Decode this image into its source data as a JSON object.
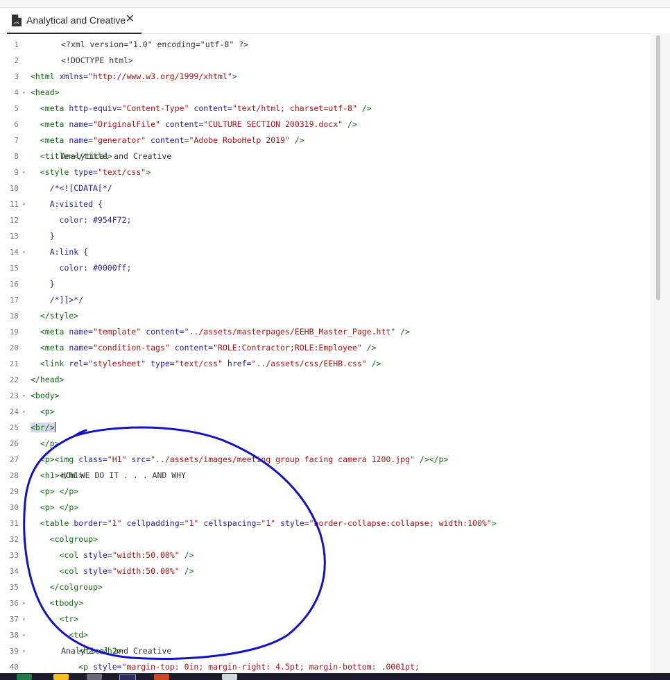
{
  "tab": {
    "title": "Analytical and Creative",
    "icon": "html-file-icon",
    "close_glyph": "✕"
  },
  "editor": {
    "lines": [
      {
        "n": "1",
        "fold": "",
        "segs": [
          {
            "t": "<?xml version=\"1.0\" encoding=\"utf-8\" ?>",
            "c": "code"
          }
        ]
      },
      {
        "n": "2",
        "fold": "",
        "segs": [
          {
            "t": "<!DOCTYPE html>",
            "c": "code"
          }
        ]
      },
      {
        "n": "3",
        "fold": "",
        "segs": [
          {
            "t": "<html ",
            "c": "tg"
          },
          {
            "t": "xmlns=",
            "c": "at"
          },
          {
            "t": "\"http://www.w3.org/1999/xhtml\"",
            "c": "st"
          },
          {
            "t": ">",
            "c": "tg"
          }
        ]
      },
      {
        "n": "4",
        "fold": "▾",
        "segs": [
          {
            "t": "<head>",
            "c": "tg"
          }
        ]
      },
      {
        "n": "5",
        "fold": "",
        "segs": [
          {
            "t": "  <meta ",
            "c": "tg"
          },
          {
            "t": "http-equiv=",
            "c": "at"
          },
          {
            "t": "\"Content-Type\"",
            "c": "st"
          },
          {
            "t": " content=",
            "c": "at"
          },
          {
            "t": "\"text/html; charset=utf-8\"",
            "c": "st"
          },
          {
            "t": " />",
            "c": "tg"
          }
        ]
      },
      {
        "n": "6",
        "fold": "",
        "segs": [
          {
            "t": "  <meta ",
            "c": "tg"
          },
          {
            "t": "name=",
            "c": "at"
          },
          {
            "t": "\"OriginalFile\"",
            "c": "st"
          },
          {
            "t": " content=",
            "c": "at"
          },
          {
            "t": "\"CULTURE SECTION 200319.docx\"",
            "c": "st"
          },
          {
            "t": " />",
            "c": "tg"
          }
        ]
      },
      {
        "n": "7",
        "fold": "",
        "segs": [
          {
            "t": "  <meta ",
            "c": "tg"
          },
          {
            "t": "name=",
            "c": "at"
          },
          {
            "t": "\"generator\"",
            "c": "st"
          },
          {
            "t": " content=",
            "c": "at"
          },
          {
            "t": "\"Adobe RoboHelp 2019\"",
            "c": "st"
          },
          {
            "t": " />",
            "c": "tg"
          }
        ]
      },
      {
        "n": "8",
        "fold": "",
        "segs": [
          {
            "t": "  <title>",
            "c": "tg"
          },
          {
            "t": "Analytical and Creative",
            "c": "code"
          },
          {
            "t": "</title>",
            "c": "tg"
          }
        ]
      },
      {
        "n": "9",
        "fold": "▾",
        "segs": [
          {
            "t": "  <style ",
            "c": "tg"
          },
          {
            "t": "type=",
            "c": "at"
          },
          {
            "t": "\"text/css\"",
            "c": "st"
          },
          {
            "t": ">",
            "c": "tg"
          }
        ]
      },
      {
        "n": "10",
        "fold": "",
        "segs": [
          {
            "t": "    /*<![CDATA[*/",
            "c": "cm"
          }
        ]
      },
      {
        "n": "11",
        "fold": "▾",
        "segs": [
          {
            "t": "    A:visited {",
            "c": "cm"
          }
        ]
      },
      {
        "n": "12",
        "fold": "",
        "segs": [
          {
            "t": "      color: #954F72;",
            "c": "cm"
          }
        ]
      },
      {
        "n": "13",
        "fold": "",
        "segs": [
          {
            "t": "    }",
            "c": "cm"
          }
        ]
      },
      {
        "n": "14",
        "fold": "▾",
        "segs": [
          {
            "t": "    A:link {",
            "c": "cm"
          }
        ]
      },
      {
        "n": "15",
        "fold": "",
        "segs": [
          {
            "t": "      color: #0000ff;",
            "c": "cm"
          }
        ]
      },
      {
        "n": "16",
        "fold": "",
        "segs": [
          {
            "t": "    }",
            "c": "cm"
          }
        ]
      },
      {
        "n": "17",
        "fold": "",
        "segs": [
          {
            "t": "    /*]]>*/",
            "c": "cm"
          }
        ]
      },
      {
        "n": "18",
        "fold": "",
        "segs": [
          {
            "t": "  </style>",
            "c": "tg"
          }
        ]
      },
      {
        "n": "19",
        "fold": "",
        "segs": [
          {
            "t": "  <meta ",
            "c": "tg"
          },
          {
            "t": "name=",
            "c": "at"
          },
          {
            "t": "\"template\"",
            "c": "st"
          },
          {
            "t": " content=",
            "c": "at"
          },
          {
            "t": "\"../assets/masterpages/EEHB_Master_Page.htt\"",
            "c": "st"
          },
          {
            "t": " />",
            "c": "tg"
          }
        ]
      },
      {
        "n": "20",
        "fold": "",
        "segs": [
          {
            "t": "  <meta ",
            "c": "tg"
          },
          {
            "t": "name=",
            "c": "at"
          },
          {
            "t": "\"condition-tags\"",
            "c": "st"
          },
          {
            "t": " content=",
            "c": "at"
          },
          {
            "t": "\"ROLE:Contractor;ROLE:Employee\"",
            "c": "st"
          },
          {
            "t": " />",
            "c": "tg"
          }
        ]
      },
      {
        "n": "21",
        "fold": "",
        "segs": [
          {
            "t": "  <link ",
            "c": "tg"
          },
          {
            "t": "rel=",
            "c": "at"
          },
          {
            "t": "\"stylesheet\"",
            "c": "st"
          },
          {
            "t": " type=",
            "c": "at"
          },
          {
            "t": "\"text/css\"",
            "c": "st"
          },
          {
            "t": " href=",
            "c": "at"
          },
          {
            "t": "\"../assets/css/EEHB.css\"",
            "c": "st"
          },
          {
            "t": " />",
            "c": "tg"
          }
        ]
      },
      {
        "n": "22",
        "fold": "",
        "segs": [
          {
            "t": "</head>",
            "c": "tg"
          }
        ]
      },
      {
        "n": "23",
        "fold": "▾",
        "segs": [
          {
            "t": "<body>",
            "c": "tg"
          }
        ]
      },
      {
        "n": "24",
        "fold": "▾",
        "segs": [
          {
            "t": "  <p>",
            "c": "tg"
          }
        ]
      },
      {
        "n": "25",
        "fold": "",
        "segs": [
          {
            "t": "    ",
            "c": "code"
          },
          {
            "t": "<br/>",
            "c": "tg sel"
          },
          {
            "t": "",
            "c": "caret"
          }
        ]
      },
      {
        "n": "26",
        "fold": "",
        "segs": [
          {
            "t": "  </p>",
            "c": "tg"
          }
        ]
      },
      {
        "n": "27",
        "fold": "",
        "segs": [
          {
            "t": "  <p>",
            "c": "tg"
          },
          {
            "t": "<img ",
            "c": "tg"
          },
          {
            "t": "class=",
            "c": "at"
          },
          {
            "t": "\"H1\"",
            "c": "st"
          },
          {
            "t": " src=",
            "c": "at"
          },
          {
            "t": "\"../assets/images/meeting group facing camera 1200.jpg\"",
            "c": "st"
          },
          {
            "t": " /></p>",
            "c": "tg"
          }
        ]
      },
      {
        "n": "28",
        "fold": "",
        "segs": [
          {
            "t": "  <h1>",
            "c": "tg"
          },
          {
            "t": "HOW WE DO IT . . . AND WHY",
            "c": "code"
          },
          {
            "t": "</h1>",
            "c": "tg"
          }
        ]
      },
      {
        "n": "29",
        "fold": "",
        "segs": [
          {
            "t": "  <p> </p>",
            "c": "tg"
          }
        ]
      },
      {
        "n": "30",
        "fold": "",
        "segs": [
          {
            "t": "  <p> </p>",
            "c": "tg"
          }
        ]
      },
      {
        "n": "31",
        "fold": "▾",
        "segs": [
          {
            "t": "  <table ",
            "c": "tg"
          },
          {
            "t": "border=",
            "c": "at"
          },
          {
            "t": "\"1\"",
            "c": "st"
          },
          {
            "t": " cellpadding=",
            "c": "at"
          },
          {
            "t": "\"1\"",
            "c": "st"
          },
          {
            "t": " cellspacing=",
            "c": "at"
          },
          {
            "t": "\"1\"",
            "c": "st"
          },
          {
            "t": " style=",
            "c": "at"
          },
          {
            "t": "\"border-collapse:collapse; width:100%\"",
            "c": "st"
          },
          {
            "t": ">",
            "c": "tg"
          }
        ]
      },
      {
        "n": "32",
        "fold": "▾",
        "segs": [
          {
            "t": "    <colgroup>",
            "c": "tg"
          }
        ]
      },
      {
        "n": "33",
        "fold": "",
        "segs": [
          {
            "t": "      <col ",
            "c": "tg"
          },
          {
            "t": "style=",
            "c": "at"
          },
          {
            "t": "\"width:50.00%\"",
            "c": "st"
          },
          {
            "t": " />",
            "c": "tg"
          }
        ]
      },
      {
        "n": "34",
        "fold": "",
        "segs": [
          {
            "t": "      <col ",
            "c": "tg"
          },
          {
            "t": "style=",
            "c": "at"
          },
          {
            "t": "\"width:50.00%\"",
            "c": "st"
          },
          {
            "t": " />",
            "c": "tg"
          }
        ]
      },
      {
        "n": "35",
        "fold": "",
        "segs": [
          {
            "t": "    </colgroup>",
            "c": "tg"
          }
        ]
      },
      {
        "n": "36",
        "fold": "▾",
        "segs": [
          {
            "t": "    <tbody>",
            "c": "tg"
          }
        ]
      },
      {
        "n": "37",
        "fold": "▾",
        "segs": [
          {
            "t": "      <tr>",
            "c": "tg"
          }
        ]
      },
      {
        "n": "38",
        "fold": "▾",
        "segs": [
          {
            "t": "        <td>",
            "c": "tg"
          }
        ]
      },
      {
        "n": "39",
        "fold": "▾",
        "segs": [
          {
            "t": "          <h2>",
            "c": "tg"
          },
          {
            "t": "Analytical and Creative",
            "c": "code"
          },
          {
            "t": "</h2>",
            "c": "tg"
          }
        ]
      },
      {
        "n": "40",
        "fold": "",
        "segs": [
          {
            "t": "          <p ",
            "c": "tg"
          },
          {
            "t": "style=",
            "c": "at"
          },
          {
            "t": "\"margin-top: 0in; margin-right: 4.5pt; margin-bottom: .0001pt;",
            "c": "st"
          }
        ]
      }
    ]
  },
  "colors": {
    "tag": "#116611",
    "attr": "#222299",
    "string": "#aa1111",
    "annotation": "#1111cc"
  },
  "taskbar": {
    "icons": [
      "excel-icon",
      "file-explorer-icon",
      "vs-icon",
      "robohelp-icon",
      "powerpoint-icon",
      "chrome-icon"
    ],
    "robohelp_label": "Rh"
  }
}
